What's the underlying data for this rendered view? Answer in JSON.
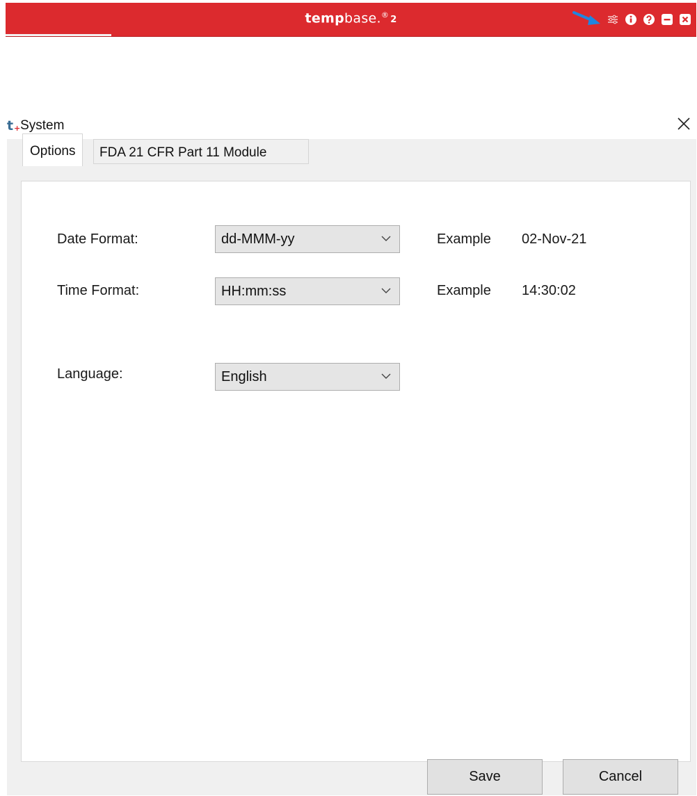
{
  "app_bar": {
    "brand_part1": "temp",
    "brand_part2": "base.",
    "brand_reg": "®",
    "brand_version": "2",
    "icons": [
      "menu-sliders-icon",
      "info-icon",
      "help-icon",
      "minimize-icon",
      "close-icon"
    ],
    "color": "#dc2a2e"
  },
  "dialog": {
    "logo": "t",
    "logo_plus": "+",
    "title": "System",
    "close_icon": "close-icon",
    "tabs": [
      {
        "label": "Options",
        "active": true
      },
      {
        "label": "FDA 21 CFR Part 11 Module",
        "active": false
      }
    ],
    "date_format": {
      "label": "Date Format:",
      "value": "dd-MMM-yy",
      "example_label": "Example",
      "example_value": "02-Nov-21"
    },
    "time_format": {
      "label": "Time Format:",
      "value": "HH:mm:ss",
      "example_label": "Example",
      "example_value": "14:30:02"
    },
    "language": {
      "label": "Language:",
      "value": "English"
    },
    "buttons": {
      "save": "Save",
      "cancel": "Cancel"
    }
  },
  "colors": {
    "accent_blue": "#3a6d94",
    "arrow_blue": "#1f86e0",
    "brand_red": "#dc2a2e"
  }
}
